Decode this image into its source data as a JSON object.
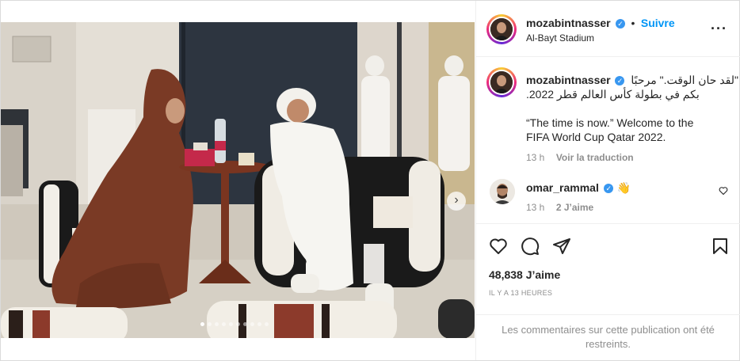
{
  "post": {
    "username": "mozabintnasser",
    "follow_label": "Suivre",
    "location": "Al-Bayt Stadium",
    "more_icon": "more-horizontal-icon"
  },
  "caption": {
    "username": "mozabintnasser",
    "arabic_line1": "لقد حان الوقت.\" مرحبًا\"",
    "arabic_line2": ".بكم في بطولة كأس العالم قطر 2022",
    "english_line1": "“The time is now.” Welcome to the",
    "english_line2": "FIFA World Cup Qatar 2022.",
    "time": "13 h",
    "translate_label": "Voir la traduction"
  },
  "comment": {
    "username": "omar_rammal",
    "emoji": "👋",
    "time": "13 h",
    "likes": "2 J’aime"
  },
  "actions": {
    "like_icon": "heart-icon",
    "comment_icon": "comment-icon",
    "share_icon": "send-icon",
    "save_icon": "bookmark-icon"
  },
  "likes_count": "48,838 J’aime",
  "posted_ago": "IL Y A 13 HEURES",
  "comments_restricted": {
    "line1": "Les commentaires sur cette publication ont été",
    "line2": "restreints."
  },
  "carousel": {
    "total": 10,
    "active": 1
  },
  "colors": {
    "accent": "#0095f6",
    "verified": "#3897f0",
    "robe": "#7a3a25"
  }
}
